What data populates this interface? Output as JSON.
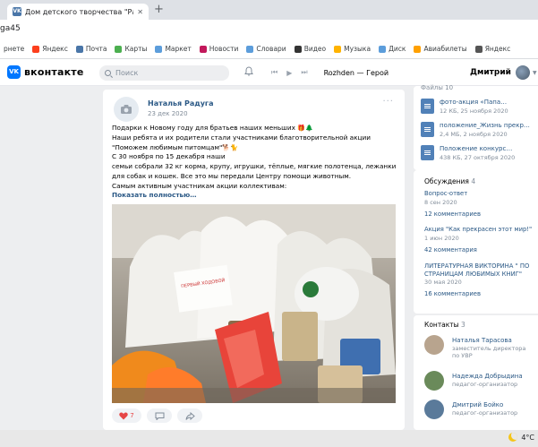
{
  "browser": {
    "tab_title": "Дом детского творчества \"Радуга\"",
    "tab_close": "✕",
    "new_tab": "+",
    "address": "ga45"
  },
  "bookmarks": [
    {
      "label": "рнете",
      "color": "#ffffff"
    },
    {
      "label": "Яндекс",
      "color": "#fc3f1d"
    },
    {
      "label": "Почта",
      "color": "#4a76a8"
    },
    {
      "label": "Карты",
      "color": "#4caf50"
    },
    {
      "label": "Маркет",
      "color": "#5c9ddb"
    },
    {
      "label": "Новости",
      "color": "#c2185b"
    },
    {
      "label": "Словари",
      "color": "#5c9ddb"
    },
    {
      "label": "Видео",
      "color": "#333333"
    },
    {
      "label": "Музыка",
      "color": "#ffb300"
    },
    {
      "label": "Диск",
      "color": "#5c9ddb"
    },
    {
      "label": "Авиабилеты",
      "color": "#ffa000"
    },
    {
      "label": "Яндекс",
      "color": "#555555"
    }
  ],
  "vk": {
    "logo_mark": "VK",
    "logo_text": "вконтакте",
    "search_placeholder": "Поиск",
    "player": {
      "prev": "⏮",
      "play": "▶",
      "next": "⏭",
      "track": "Rozhden — Герой"
    },
    "user_name": "Дмитрий"
  },
  "post": {
    "author": "Наталья Радуга",
    "date": "23 дек 2020",
    "menu": "···",
    "lines": [
      "Подарки к Новому году для братьев наших меньших",
      "Наши ребята и их родители стали участниками благотворительной акции",
      "\"Поможем любимым питомцам\"",
      "С 30 ноября по 15 декабря наши",
      "семьи собрали 32 кг корма, крупу, игрушки, тёплые, мягкие полотенца, лежанки",
      "для собак и кошек. Все это мы передали Центру помощи животным.",
      "Самым активным участникам акции коллективам:"
    ],
    "show_more": "Показать полностью…",
    "photo_label": "ПЕРВЫЙ ХОДОВОЙ",
    "likes": "7"
  },
  "files": {
    "header": "Файлы",
    "count": "10",
    "items": [
      {
        "name": "фото-акция «Папа…",
        "meta": "12 КБ, 25 ноября 2020"
      },
      {
        "name": "положение_Жизнь прекр…",
        "meta": "2,4 МБ, 2 ноября 2020"
      },
      {
        "name": "Положение конкурс…",
        "meta": "438 КБ, 27 октября 2020"
      }
    ]
  },
  "discussions": {
    "header": "Обсуждения",
    "count": "4",
    "items": [
      {
        "title": "Вопрос-ответ",
        "date": "8 сен 2020",
        "comments": "12 комментариев"
      },
      {
        "title": "Акция \"Как прекрасен этот мир!\"",
        "date": "1 июн 2020",
        "comments": "42 комментария"
      },
      {
        "title": "ЛИТЕРАТУРНАЯ ВИКТОРИНА \" ПО СТРАНИЦАМ ЛЮБИМЫХ КНИГ\"",
        "date": "30 мая 2020",
        "comments": "16 комментариев"
      }
    ]
  },
  "contacts": {
    "header": "Контакты",
    "count": "3",
    "items": [
      {
        "name": "Наталья Тарасова",
        "role": "заместитель директора по УВР",
        "color": "#b8a48e"
      },
      {
        "name": "Надежда Добрыдина",
        "role": "педагог-организатор",
        "color": "#6a8a5a"
      },
      {
        "name": "Дмитрий Бойко",
        "role": "педагог-организатор",
        "color": "#5a7a9a"
      }
    ]
  },
  "taskbar": {
    "weather": "4°C"
  },
  "colors": {
    "vk_blue": "#0077ff",
    "link": "#2a5885",
    "like_red": "#e64646"
  }
}
